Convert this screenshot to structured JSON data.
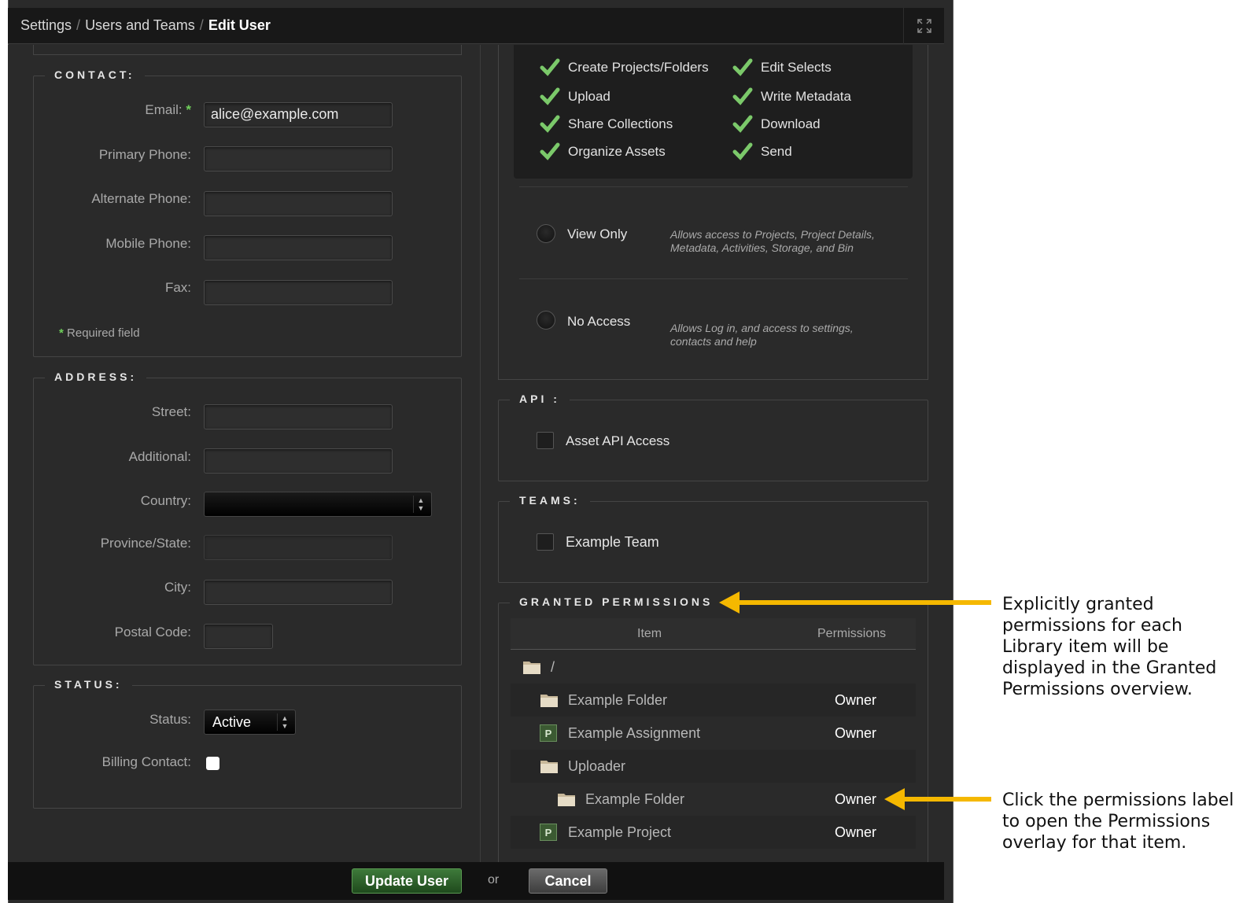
{
  "breadcrumb": {
    "items": [
      "Settings",
      "Users and Teams"
    ],
    "current": "Edit User"
  },
  "contact": {
    "legend": "CONTACT:",
    "email_label": "Email:",
    "email_value": "alice@example.com",
    "primary_phone_label": "Primary Phone:",
    "alternate_phone_label": "Alternate Phone:",
    "mobile_phone_label": "Mobile Phone:",
    "fax_label": "Fax:",
    "required_note": "Required field",
    "required_marker": "*"
  },
  "address": {
    "legend": "ADDRESS:",
    "street_label": "Street:",
    "additional_label": "Additional:",
    "country_label": "Country:",
    "country_value": "",
    "province_label": "Province/State:",
    "city_label": "City:",
    "postal_label": "Postal Code:"
  },
  "status": {
    "legend": "STATUS:",
    "status_label": "Status:",
    "status_value": "Active",
    "billing_label": "Billing Contact:",
    "billing_checked": false
  },
  "rights": {
    "col1": [
      "Create Projects/Folders",
      "Upload",
      "Share Collections",
      "Organize Assets"
    ],
    "col2": [
      "Edit Selects",
      "Write Metadata",
      "Download",
      "Send"
    ],
    "view_only_label": "View Only",
    "view_only_desc": "Allows access to Projects, Project Details, Metadata, Activities, Storage, and Bin",
    "no_access_label": "No Access",
    "no_access_desc": "Allows Log in, and access to settings, contacts and help"
  },
  "api": {
    "legend": "API :",
    "asset_api_label": "Asset API Access"
  },
  "teams": {
    "legend": "TEAMS:",
    "team_label": "Example Team"
  },
  "granted": {
    "legend": "GRANTED PERMISSIONS",
    "col_item": "Item",
    "col_permissions": "Permissions",
    "rows": [
      {
        "name": "/",
        "icon": "folder-icon",
        "permission": ""
      },
      {
        "name": "Example Folder",
        "icon": "folder-icon",
        "permission": "Owner"
      },
      {
        "name": "Example Assignment",
        "icon": "project-icon",
        "permission": "Owner"
      },
      {
        "name": "Uploader",
        "icon": "folder-icon",
        "permission": ""
      },
      {
        "name": "Example Folder",
        "icon": "folder-icon",
        "permission": "Owner"
      },
      {
        "name": "Example Project",
        "icon": "project-icon",
        "permission": "Owner"
      }
    ]
  },
  "footer": {
    "update_label": "Update User",
    "or_label": "or",
    "cancel_label": "Cancel"
  },
  "annotations": {
    "granted": "Explicitly granted permissions for each Library item will be displayed in the Granted Permissions overview.",
    "click": "Click the permissions label to open the Permissions overlay for that item."
  },
  "colors": {
    "accent_green": "#6fcf5b",
    "arrow": "#f5b800",
    "background": "#2a2a2a"
  },
  "project_icon_letter": "P"
}
